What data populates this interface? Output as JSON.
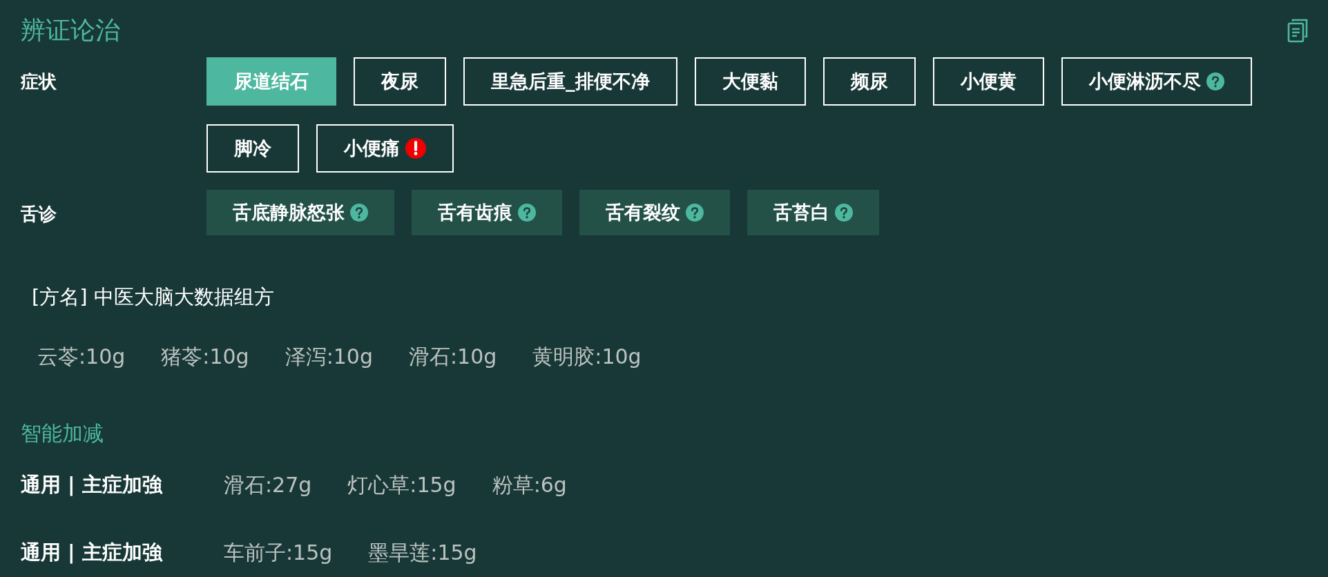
{
  "title": "辨证论治",
  "sections": [
    {
      "label": "症状",
      "kind": "outlined",
      "tags": [
        {
          "label": "尿道结石",
          "selected": true
        },
        {
          "label": "夜尿",
          "selected": false
        },
        {
          "label": "里急后重_排便不净",
          "selected": false
        },
        {
          "label": "大便黏",
          "selected": false
        },
        {
          "label": "频尿",
          "selected": false
        },
        {
          "label": "小便黄",
          "selected": false
        },
        {
          "label": "小便淋沥不尽",
          "selected": false,
          "kind": "help"
        },
        {
          "label": "脚冷",
          "selected": false
        },
        {
          "label": "小便痛",
          "selected": false,
          "kind": "alert"
        }
      ]
    },
    {
      "label": "舌诊",
      "kind": "filled",
      "tags": [
        {
          "label": "舌底静脉怒张",
          "selected": false,
          "kind": "help"
        },
        {
          "label": "舌有齿痕",
          "selected": false,
          "kind": "help"
        },
        {
          "label": "舌有裂纹",
          "selected": false,
          "kind": "help"
        },
        {
          "label": "舌苔白",
          "selected": false,
          "kind": "help"
        }
      ]
    }
  ],
  "formula": {
    "name": "[方名] 中医大脑大数据组方",
    "herbs": [
      "云苓:10g",
      "猪苓:10g",
      "泽泻:10g",
      "滑石:10g",
      "黄明胶:10g"
    ]
  },
  "adjust": {
    "title": "智能加减",
    "rows": [
      {
        "label": "通用 | 主症加強",
        "herbs": [
          "滑石:27g",
          "灯心草:15g",
          "粉草:6g"
        ]
      },
      {
        "label": "通用 | 主症加強",
        "herbs": [
          "车前子:15g",
          "墨旱莲:15g"
        ]
      }
    ]
  }
}
